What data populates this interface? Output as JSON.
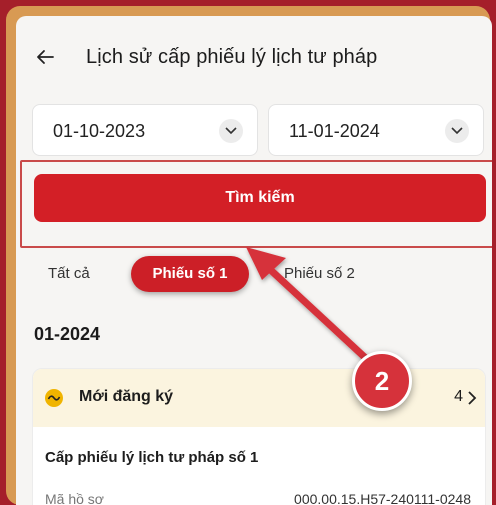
{
  "header": {
    "title": "Lịch sử cấp phiếu lý lịch tư pháp",
    "back_icon": "arrow-left-icon"
  },
  "filters": {
    "from_date": "01-10-2023",
    "to_date": "11-01-2024"
  },
  "search": {
    "label": "Tìm kiếm"
  },
  "tabs": [
    {
      "label": "Tất cả",
      "active": false
    },
    {
      "label": "Phiếu số 1",
      "active": true
    },
    {
      "label": "Phiếu số 2",
      "active": false
    }
  ],
  "section": {
    "date": "01-2024"
  },
  "card": {
    "status": "Mới đăng ký",
    "status_color": "#f0b400",
    "header_right": "4",
    "title": "Cấp phiếu lý lịch tư pháp số 1",
    "field_label": "Mã hồ sơ",
    "field_value": "000.00.15.H57-240111-0248"
  },
  "annotation": {
    "step": "2",
    "color": "#d6323b"
  }
}
